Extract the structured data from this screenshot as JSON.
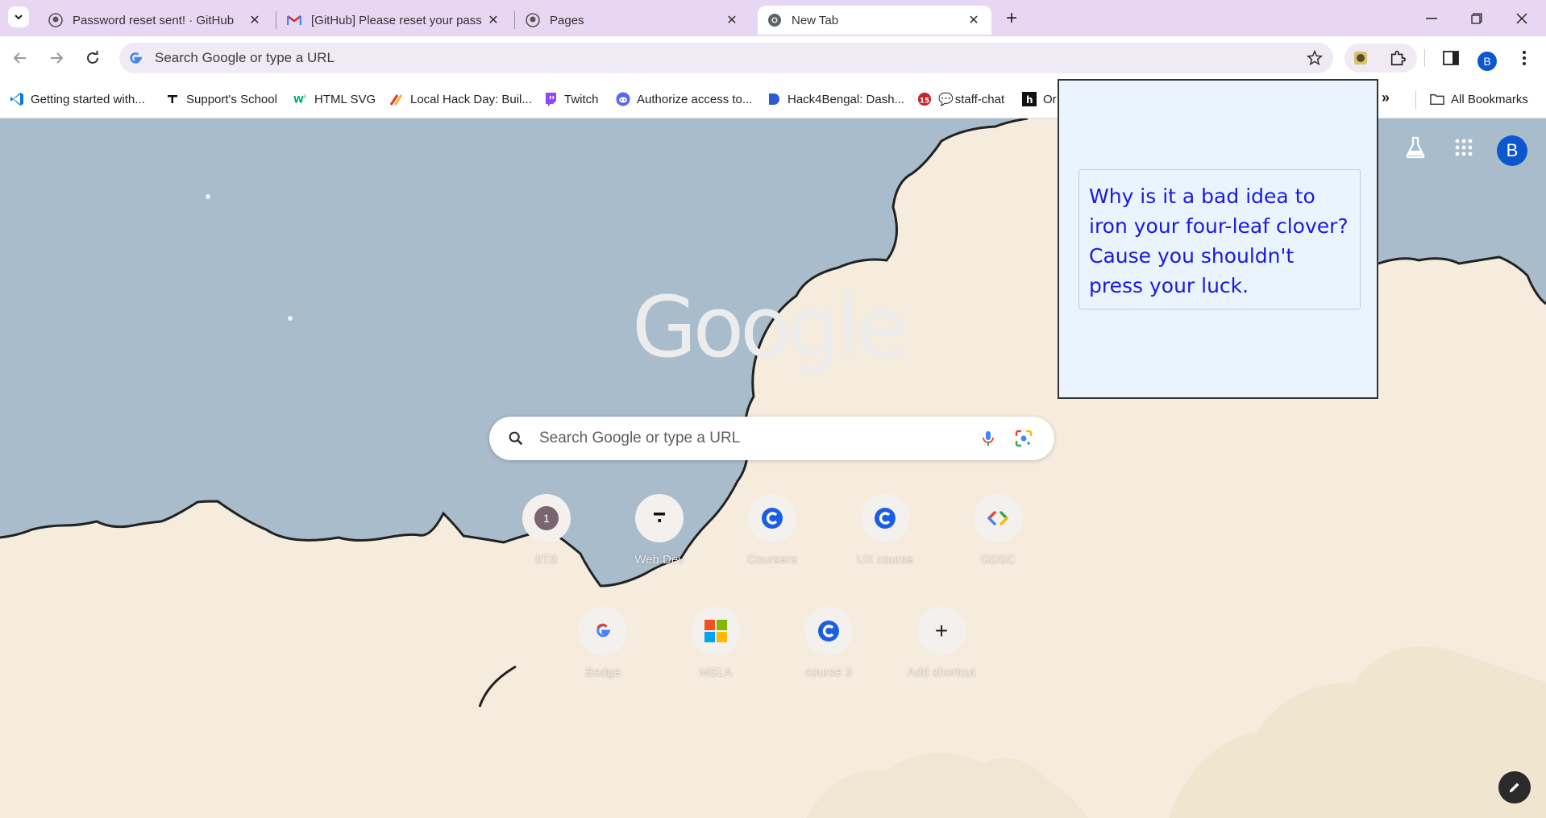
{
  "tabs": [
    {
      "title": "Password reset sent! · GitHub",
      "favicon": "github-icon",
      "active": false
    },
    {
      "title": "[GitHub] Please reset your pass",
      "favicon": "gmail-icon",
      "active": false
    },
    {
      "title": "Pages",
      "favicon": "github-icon",
      "active": false
    },
    {
      "title": "New Tab",
      "favicon": "chrome-icon",
      "active": true
    }
  ],
  "omnibox": {
    "text": "Search Google or type a URL"
  },
  "profile_initial": "B",
  "bookmarks": [
    {
      "label": "Getting started with...",
      "icon": "vscode-icon"
    },
    {
      "label": "Support's School",
      "icon": "support-icon"
    },
    {
      "label": "HTML SVG",
      "icon": "w3-icon"
    },
    {
      "label": "Local Hack Day: Buil...",
      "icon": "mlh-icon"
    },
    {
      "label": "Twitch",
      "icon": "twitch-icon"
    },
    {
      "label": "Authorize access to...",
      "icon": "discord-icon"
    },
    {
      "label": "Hack4Bengal: Dash...",
      "icon": "hack4bengal-icon"
    },
    {
      "label": "staff-chat",
      "icon": "chat-icon",
      "badge": "15"
    },
    {
      "label": "Or",
      "icon": "h-icon"
    }
  ],
  "all_bookmarks_label": "All Bookmarks",
  "newtab": {
    "logo": "Google",
    "search_placeholder": "Search Google or type a URL",
    "shortcuts": [
      {
        "label": "IITB",
        "glyph": "1"
      },
      {
        "label": "Web Dev",
        "glyph": "ᆕ"
      },
      {
        "label": "Coursera",
        "glyph": "C"
      },
      {
        "label": "UX course",
        "glyph": "C"
      },
      {
        "label": "GDSC",
        "glyph": "<>"
      },
      {
        "label": "Badge",
        "glyph": "G"
      },
      {
        "label": "MSLA",
        "glyph": "ms"
      },
      {
        "label": "course 3",
        "glyph": "C"
      },
      {
        "label": "Add shortcut",
        "glyph": "+"
      }
    ]
  },
  "popup": {
    "joke": "Why is it a bad idea to iron your four-leaf clover? Cause you shouldn't press your luck."
  },
  "colors": {
    "accent": "#0b57d0",
    "tabstrip": "#e8d7f2",
    "popup_bg": "#eaf4ff",
    "joke_text": "#1a1adb"
  }
}
